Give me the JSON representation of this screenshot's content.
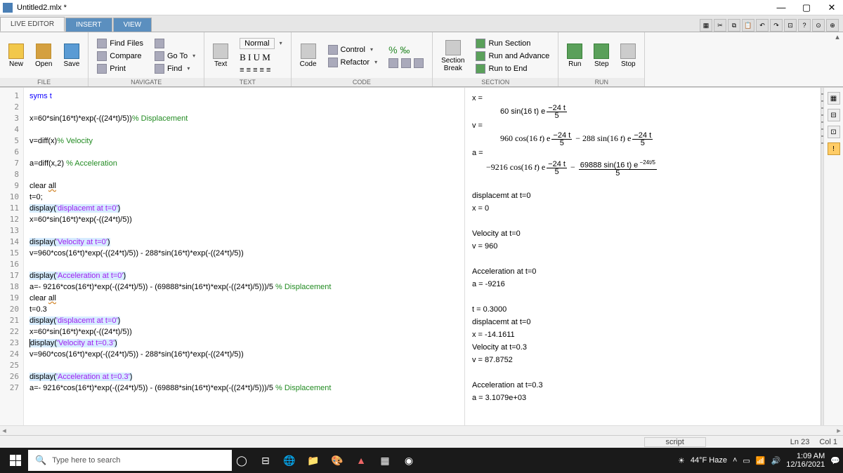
{
  "window": {
    "title": "Untitled2.mlx *"
  },
  "tabs": [
    "LIVE EDITOR",
    "INSERT",
    "VIEW"
  ],
  "ribbon": {
    "file": {
      "label": "FILE",
      "new": "New",
      "open": "Open",
      "save": "Save"
    },
    "nav": {
      "label": "NAVIGATE",
      "findfiles": "Find Files",
      "compare": "Compare",
      "print": "Print",
      "goto": "Go To",
      "find": "Find"
    },
    "text": {
      "label": "TEXT",
      "btn": "Text",
      "normal": "Normal",
      "biun": "B I U M"
    },
    "codegrp": {
      "label": "CODE",
      "btn": "Code",
      "control": "Control",
      "refactor": "Refactor"
    },
    "section": {
      "label": "SECTION",
      "break": "Section\nBreak",
      "runsec": "Run Section",
      "runadv": "Run and Advance",
      "runend": "Run to End"
    },
    "run": {
      "label": "RUN",
      "run": "Run",
      "step": "Step",
      "stop": "Stop"
    }
  },
  "code": {
    "l1": "syms t",
    "l3a": "x=60*sin(16*t)*exp(-((24*t)/5))",
    "l3c": "% Displacement",
    "l5a": "v=diff(x)",
    "l5c": "% Velocity",
    "l7a": "a=diff(x,2) ",
    "l7c": "% Acceleration",
    "l9a": "clear ",
    "l9b": "all",
    "l10": "t=0;",
    "l11a": "display(",
    "l11s": "'displacemt at t=0'",
    "l11b": ")",
    "l12": "x=60*sin(16*t)*exp(-((24*t)/5))",
    "l14a": "display(",
    "l14s": "'Velocity at t=0'",
    "l14b": ")",
    "l15": "v=960*cos(16*t)*exp(-((24*t)/5)) - 288*sin(16*t)*exp(-((24*t)/5))",
    "l17a": "display(",
    "l17s": "'Acceleration at t=0'",
    "l17b": ")",
    "l18a": "a=- 9216*cos(16*t)*exp(-((24*t)/5)) - (69888*sin(16*t)*exp(-((24*t)/5)))/5 ",
    "l18c": "% Displacement",
    "l19a": "clear ",
    "l19b": "all",
    "l20": "t=0.3",
    "l21a": "display(",
    "l21s": "'displacemt at t=0'",
    "l21b": ")",
    "l22": "x=60*sin(16*t)*exp(-((24*t)/5))",
    "l23a": "display(",
    "l23s": "'Velocity at t=0.3'",
    "l23b": ")",
    "l24": "v=960*cos(16*t)*exp(-((24*t)/5)) - 288*sin(16*t)*exp(-((24*t)/5))",
    "l26a": "display(",
    "l26s": "'Acceleration at t=0.3'",
    "l26b": ")",
    "l27a": "a=- 9216*cos(16*t)*exp(-((24*t)/5)) - (69888*sin(16*t)*exp(-((24*t)/5)))/5 ",
    "l27c": "% Displacement"
  },
  "output": {
    "x": "x =",
    "xv": "60 sin(16 t) e",
    "v": "v =",
    "vv": "960 cos(16 t) e      − 288 sin(16 t) e",
    "a": "a =",
    "av": "−9216 cos(16 t) e      − ",
    "af": "69888 sin(16 t) e",
    "d0": "displacemt at t=0",
    "x0": "x = 0",
    "vt0": "Velocity at t=0",
    "v0": "v = 960",
    "at0": "Acceleration at t=0",
    "a0": "a = -9216",
    "t3": "t = 0.3000",
    "d3": "displacemt at t=0",
    "x3": "x = -14.1611",
    "vt3": "Velocity at t=0.3",
    "v3": "v = 87.8752",
    "at3": "Acceleration at t=0.3",
    "a3": "a = 3.1079e+03",
    "exp": "24 t",
    "expd": "5"
  },
  "status": {
    "script": "script",
    "ln": "Ln  23",
    "col": "Col  1"
  },
  "taskbar": {
    "search": "Type here to search",
    "weather": "44°F Haze",
    "time": "1:09 AM",
    "date": "12/16/2021"
  }
}
